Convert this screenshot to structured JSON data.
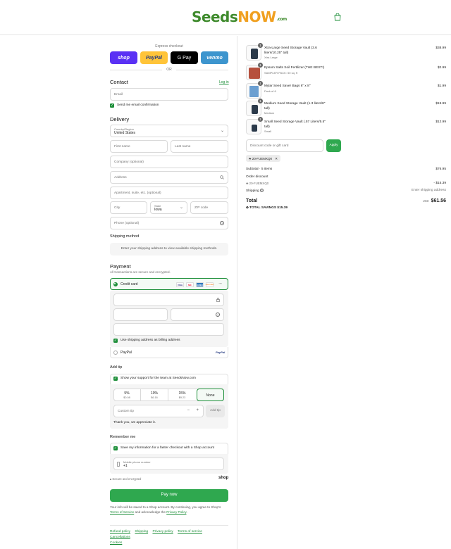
{
  "header": {
    "logo_main": "Seeds",
    "logo_now": "NOW",
    "logo_domain": ".com",
    "cart_icon": "shopping-bag-icon"
  },
  "express": {
    "title": "Express checkout",
    "buttons": [
      "shop",
      "PayPal",
      "G Pay",
      "venmo"
    ],
    "or": "OR",
    "colors": {
      "shop": "#5a31f4",
      "paypal": "#ffc439",
      "gpay": "#000000",
      "venmo": "#3d95ce"
    }
  },
  "contact": {
    "title": "Contact",
    "login": "Log in",
    "email_placeholder": "Email",
    "email_opt": "Send me email confirmation"
  },
  "delivery": {
    "title": "Delivery",
    "country_label": "Country/Region",
    "country_value": "United States",
    "first_name": "First name",
    "last_name": "Last name",
    "company": "Company (optional)",
    "address": "Address",
    "apartment": "Apartment, suite, etc. (optional)",
    "city": "City",
    "state_label": "State",
    "state_value": "Iowa",
    "zip": "ZIP code",
    "phone": "Phone (optional)"
  },
  "shipping_method": {
    "title": "Shipping method",
    "note": "Enter your shipping address to view available shipping methods."
  },
  "payment": {
    "title": "Payment",
    "subtitle": "All transactions are secure and encrypted.",
    "credit_card": "Credit card",
    "cards": [
      "VISA",
      "MC",
      "AMEX",
      "DISCOVER"
    ],
    "more": "→",
    "billing_same": "Use shipping address as billing address",
    "paypal": "PayPal",
    "paypal_logo": "PayPal"
  },
  "tip": {
    "title": "Add tip",
    "support": "Show your support for the team at SeedsNow.com",
    "options": [
      {
        "pct": "5%",
        "amt": "$0.08"
      },
      {
        "pct": "10%",
        "amt": "$6.16"
      },
      {
        "pct": "15%",
        "amt": "$9.23"
      },
      {
        "pct": "None",
        "amt": ""
      }
    ],
    "custom": "Custom tip",
    "minus": "−",
    "plus": "+",
    "add": "Add tip",
    "thanks": "Thank you, we appreciate it."
  },
  "remember": {
    "title": "Remember me",
    "save": "Save my information for a faster checkout with a Shop account",
    "mobile_label": "Mobile phone number",
    "mobile_value": "+1",
    "secure": "Secure and encrypted",
    "shop": "shop"
  },
  "pay_button": "Pay now",
  "legal": {
    "text1": "Your info will be saved to a Shop account. By continuing, you agree to Shop's",
    "terms": "Terms of Service",
    "text2": "and acknowledge the",
    "privacy": "Privacy Policy",
    "end": "."
  },
  "footer": [
    "Refund policy",
    "Shipping",
    "Privacy policy",
    "Terms of service",
    "Cancellations",
    "Cookies"
  ],
  "cart": {
    "items": [
      {
        "qty": "1",
        "name": "Xtra-Large Seed Storage Vault (3.6 liters/10.25\" tall)",
        "variant": "Xtra Large",
        "price": "$38.99"
      },
      {
        "qty": "1",
        "name": "Epsom Salts Soil Fertilizer (THE BEST!)",
        "variant": "SAMPLER PACK: 50 sq. ft",
        "price": "$2.99"
      },
      {
        "qty": "1",
        "name": "Mylar Seed Saver Bags 6\" x 8\"",
        "variant": "Pack of 6",
        "price": "$1.99"
      },
      {
        "qty": "1",
        "name": "Medium Seed Storage Vault (1.3 liters/8\" tall)",
        "variant": "Medium",
        "price": "$19.99"
      },
      {
        "qty": "1",
        "name": "Small Seed Storage Vault (.57 Liters/5.5\" tall)",
        "variant": "Small",
        "price": "$12.99"
      }
    ],
    "discount_placeholder": "Discount code or gift card",
    "apply": "Apply",
    "code": "20-FUEMXQ0",
    "subtotal_label": "Subtotal · 5 items",
    "subtotal": "$76.95",
    "order_discount": "Order discount",
    "discount_code": "20-FUEMXQ0",
    "discount_value": "- $15.39",
    "shipping_label": "Shipping",
    "shipping_value": "Enter shipping address",
    "total_label": "Total",
    "currency": "USD",
    "total": "$61.56",
    "savings": "TOTAL SAVINGS $15.39"
  }
}
